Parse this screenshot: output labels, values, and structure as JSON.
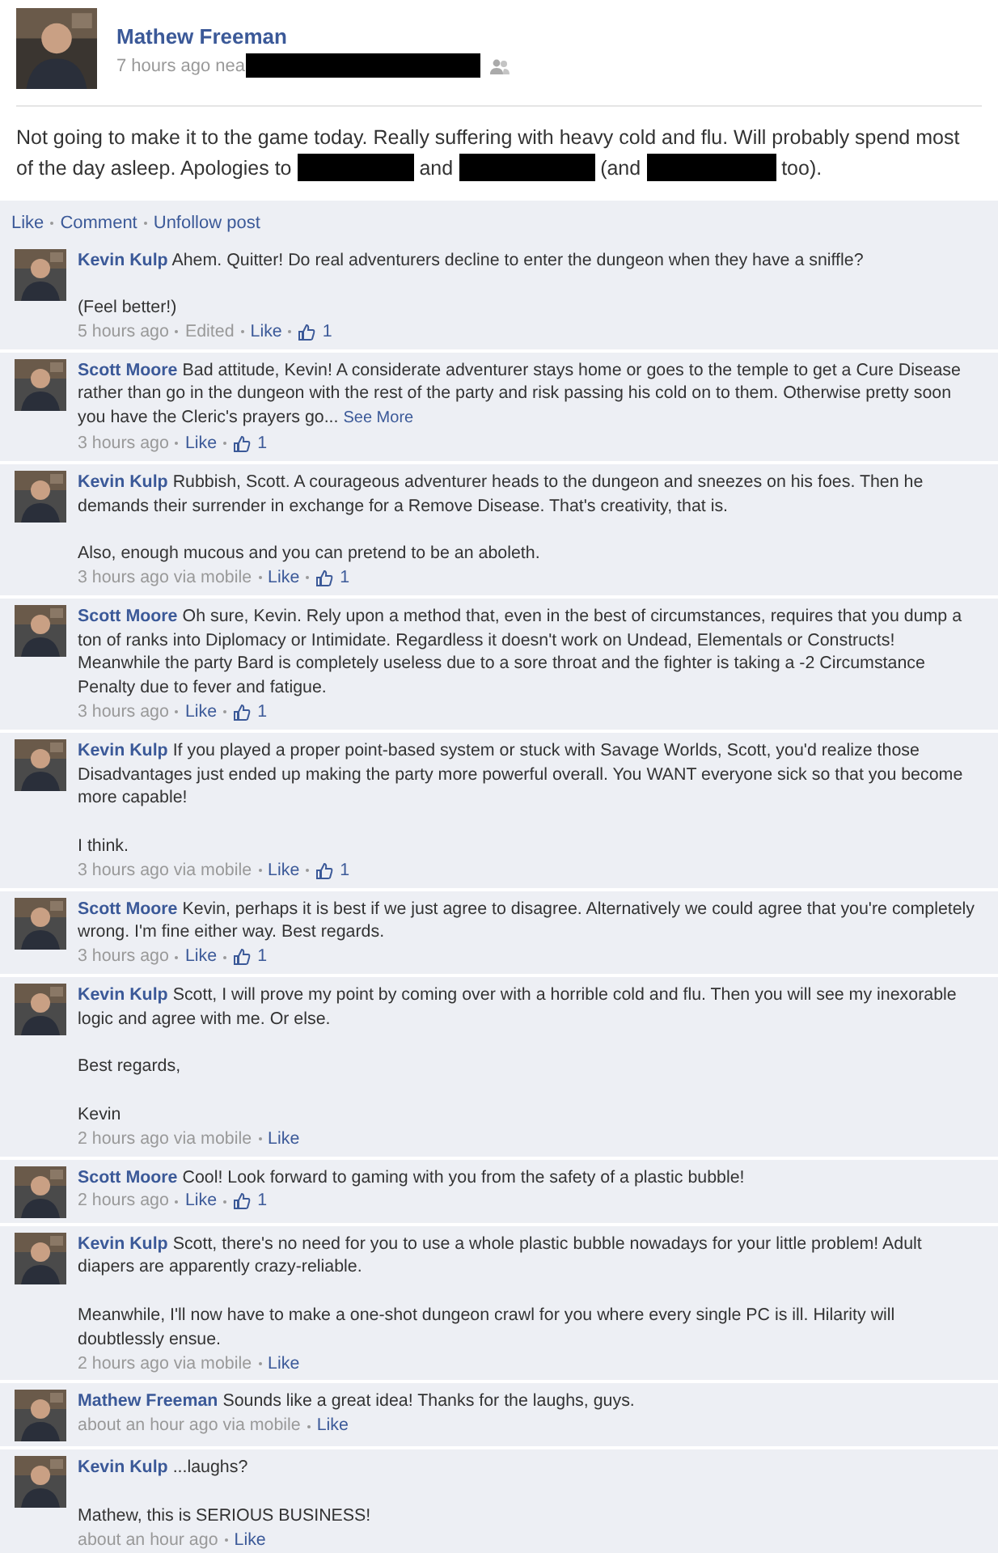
{
  "post": {
    "author": "Mathew Freeman",
    "time": "7 hours ago nea",
    "text": [
      {
        "kind": "text",
        "text": "Not going to make it to the game today. Really suffering with heavy cold and flu. Will probably spend most of the day asleep. Apologies to"
      },
      {
        "kind": "redacted"
      },
      {
        "kind": "text",
        "text": "and"
      },
      {
        "kind": "redacted"
      },
      {
        "kind": "text",
        "text": "(and"
      },
      {
        "kind": "redacted"
      },
      {
        "kind": "text",
        "text": "too)."
      }
    ],
    "actions": [
      "Like",
      "Comment",
      "Unfollow post"
    ]
  },
  "comments": [
    {
      "author": "Kevin Kulp",
      "paragraphs": [
        "Ahem. Quitter! Do real adventurers decline to enter the dungeon when they have a sniffle?",
        "(Feel better!)"
      ],
      "meta": [
        {
          "kind": "text",
          "text": "5 hours ago"
        },
        {
          "kind": "text",
          "text": "Edited"
        },
        {
          "kind": "link",
          "text": "Like"
        },
        {
          "kind": "likes",
          "text": "1"
        }
      ]
    },
    {
      "author": "Scott Moore",
      "paragraphs": [
        "Bad attitude, Kevin! A considerate adventurer stays home or goes to the temple to get a Cure Disease rather than go in the dungeon with the rest of the party and risk passing his cold on to them. Otherwise pretty soon you have the Cleric's prayers go..."
      ],
      "see_more": "See More",
      "meta": [
        {
          "kind": "text",
          "text": "3 hours ago"
        },
        {
          "kind": "link",
          "text": "Like"
        },
        {
          "kind": "likes",
          "text": "1"
        }
      ]
    },
    {
      "author": "Kevin Kulp",
      "paragraphs": [
        "Rubbish, Scott. A courageous adventurer heads to the dungeon and sneezes on his foes. Then he demands their surrender in exchange for a Remove Disease. That's creativity, that is.",
        "Also, enough mucous and you can pretend to be an aboleth."
      ],
      "meta": [
        {
          "kind": "text",
          "text": "3 hours ago via mobile"
        },
        {
          "kind": "link",
          "text": "Like"
        },
        {
          "kind": "likes",
          "text": "1"
        }
      ]
    },
    {
      "author": "Scott Moore",
      "paragraphs": [
        "Oh sure, Kevin. Rely upon a method that, even in the best of circumstances, requires that you dump a ton of ranks into Diplomacy or Intimidate. Regardless it doesn't work on Undead, Elementals or Constructs! Meanwhile the party Bard is completely useless due to a sore throat and the fighter is taking a -2 Circumstance Penalty due to fever and fatigue."
      ],
      "meta": [
        {
          "kind": "text",
          "text": "3 hours ago"
        },
        {
          "kind": "link",
          "text": "Like"
        },
        {
          "kind": "likes",
          "text": "1"
        }
      ]
    },
    {
      "author": "Kevin Kulp",
      "paragraphs": [
        "If you played a proper point-based system or stuck with Savage Worlds, Scott, you'd realize those Disadvantages just ended up making the party more powerful overall. You WANT everyone sick so that you become more capable!",
        "I think."
      ],
      "meta": [
        {
          "kind": "text",
          "text": "3 hours ago via mobile"
        },
        {
          "kind": "link",
          "text": "Like"
        },
        {
          "kind": "likes",
          "text": "1"
        }
      ]
    },
    {
      "author": "Scott Moore",
      "paragraphs": [
        "Kevin, perhaps it is best if we just agree to disagree. Alternatively we could agree that you're completely wrong. I'm fine either way. Best regards."
      ],
      "meta": [
        {
          "kind": "text",
          "text": "3 hours ago"
        },
        {
          "kind": "link",
          "text": "Like"
        },
        {
          "kind": "likes",
          "text": "1"
        }
      ]
    },
    {
      "author": "Kevin Kulp",
      "paragraphs": [
        "Scott, I will prove my point by coming over with a horrible cold and flu. Then you will see my inexorable logic and agree with me. Or else.",
        "Best regards,",
        "Kevin"
      ],
      "meta": [
        {
          "kind": "text",
          "text": "2 hours ago via mobile"
        },
        {
          "kind": "link",
          "text": "Like"
        }
      ]
    },
    {
      "author": "Scott Moore",
      "paragraphs": [
        "Cool! Look forward to gaming with you from the safety of a plastic bubble!"
      ],
      "meta": [
        {
          "kind": "text",
          "text": "2 hours ago"
        },
        {
          "kind": "link",
          "text": "Like"
        },
        {
          "kind": "likes",
          "text": "1"
        }
      ]
    },
    {
      "author": "Kevin Kulp",
      "paragraphs": [
        "Scott, there's no need for you to use a whole plastic bubble nowadays for your little problem! Adult diapers are apparently crazy-reliable.",
        "Meanwhile, I'll now have to make a one-shot dungeon crawl for you where every single PC is ill. Hilarity will doubtlessly ensue."
      ],
      "meta": [
        {
          "kind": "text",
          "text": "2 hours ago via mobile"
        },
        {
          "kind": "link",
          "text": "Like"
        }
      ]
    },
    {
      "author": "Mathew Freeman",
      "paragraphs": [
        "Sounds like a great idea! Thanks for the laughs, guys."
      ],
      "meta": [
        {
          "kind": "text",
          "text": "about an hour ago via mobile"
        },
        {
          "kind": "link",
          "text": "Like"
        }
      ]
    },
    {
      "author": "Kevin Kulp",
      "paragraphs": [
        "...laughs?",
        "Mathew, this is SERIOUS BUSINESS!"
      ],
      "meta": [
        {
          "kind": "text",
          "text": "about an hour ago"
        },
        {
          "kind": "link",
          "text": "Like"
        }
      ]
    }
  ]
}
